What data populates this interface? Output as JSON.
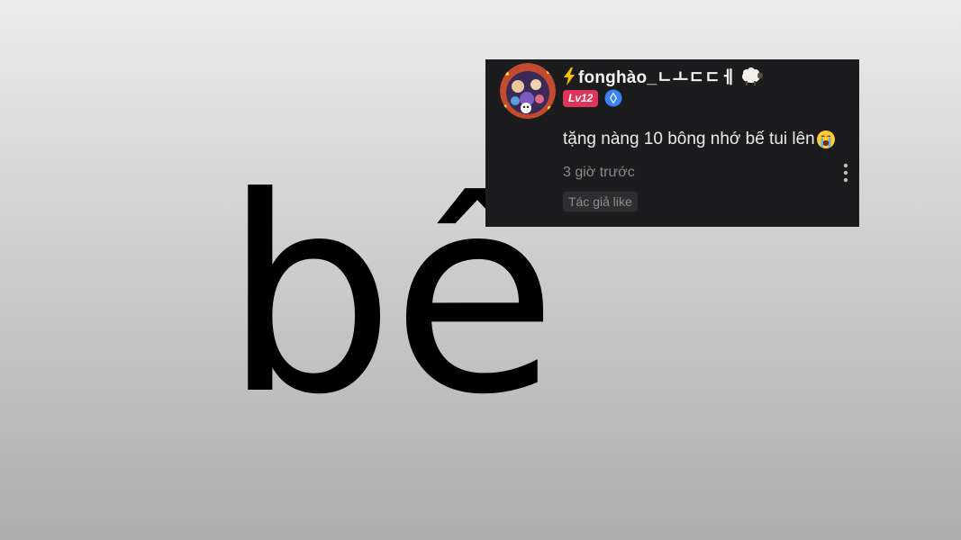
{
  "caption": {
    "word": "bế"
  },
  "comment": {
    "username": "fonghào_ㄴㅗㄷㄷㅔ",
    "username_prefix_icon": "lightning-bolt-icon",
    "username_suffix_icon": "sheep-emoji-icon",
    "level_badge": "Lv12",
    "verify_icon": "blue-diamond-badge-icon",
    "text": "tặng nàng 10 bông nhớ bế tui lên",
    "text_suffix_icon": "crying-face-emoji-icon",
    "timestamp": "3 giờ trước",
    "author_like": "Tác giả like",
    "more_icon": "vertical-dots-icon"
  },
  "colors": {
    "card_background": "#1c1c1e",
    "level_badge": "#e0355a",
    "verify_badge": "#3b82f6",
    "muted_text": "#8a8a8a"
  }
}
